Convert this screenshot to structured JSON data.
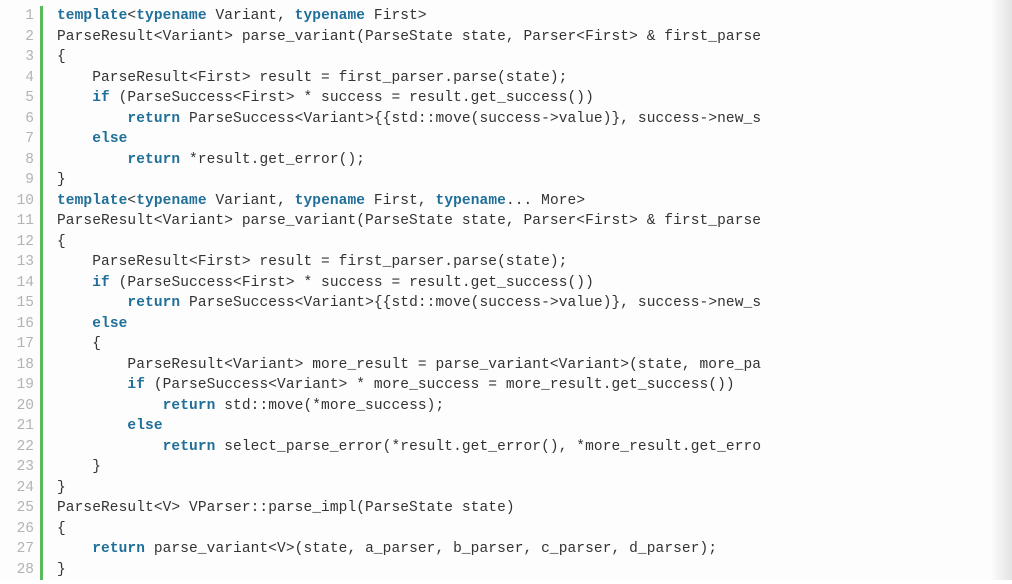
{
  "code": {
    "lines": [
      {
        "n": "1",
        "segs": [
          [
            "kw",
            "template"
          ],
          [
            "t",
            "<"
          ],
          [
            "kw",
            "typename"
          ],
          [
            "t",
            " Variant, "
          ],
          [
            "kw",
            "typename"
          ],
          [
            "t",
            " First>"
          ]
        ]
      },
      {
        "n": "2",
        "segs": [
          [
            "t",
            "ParseResult<Variant> parse_variant(ParseState state, Parser<First> & first_parse"
          ]
        ]
      },
      {
        "n": "3",
        "segs": [
          [
            "t",
            "{"
          ]
        ]
      },
      {
        "n": "4",
        "segs": [
          [
            "t",
            "    ParseResult<First> result = first_parser.parse(state);"
          ]
        ]
      },
      {
        "n": "5",
        "segs": [
          [
            "t",
            "    "
          ],
          [
            "kw",
            "if"
          ],
          [
            "t",
            " (ParseSuccess<First> * success = result.get_success())"
          ]
        ]
      },
      {
        "n": "6",
        "segs": [
          [
            "t",
            "        "
          ],
          [
            "kw",
            "return"
          ],
          [
            "t",
            " ParseSuccess<Variant>{{std::move(success->value)}, success->new_s"
          ]
        ]
      },
      {
        "n": "7",
        "segs": [
          [
            "t",
            "    "
          ],
          [
            "kw",
            "else"
          ]
        ]
      },
      {
        "n": "8",
        "segs": [
          [
            "t",
            "        "
          ],
          [
            "kw",
            "return"
          ],
          [
            "t",
            " *result.get_error();"
          ]
        ]
      },
      {
        "n": "9",
        "segs": [
          [
            "t",
            "}"
          ]
        ]
      },
      {
        "n": "10",
        "segs": [
          [
            "kw",
            "template"
          ],
          [
            "t",
            "<"
          ],
          [
            "kw",
            "typename"
          ],
          [
            "t",
            " Variant, "
          ],
          [
            "kw",
            "typename"
          ],
          [
            "t",
            " First, "
          ],
          [
            "kw",
            "typename"
          ],
          [
            "t",
            "... More>"
          ]
        ]
      },
      {
        "n": "11",
        "segs": [
          [
            "t",
            "ParseResult<Variant> parse_variant(ParseState state, Parser<First> & first_parse"
          ]
        ]
      },
      {
        "n": "12",
        "segs": [
          [
            "t",
            "{"
          ]
        ]
      },
      {
        "n": "13",
        "segs": [
          [
            "t",
            "    ParseResult<First> result = first_parser.parse(state);"
          ]
        ]
      },
      {
        "n": "14",
        "segs": [
          [
            "t",
            "    "
          ],
          [
            "kw",
            "if"
          ],
          [
            "t",
            " (ParseSuccess<First> * success = result.get_success())"
          ]
        ]
      },
      {
        "n": "15",
        "segs": [
          [
            "t",
            "        "
          ],
          [
            "kw",
            "return"
          ],
          [
            "t",
            " ParseSuccess<Variant>{{std::move(success->value)}, success->new_s"
          ]
        ]
      },
      {
        "n": "16",
        "segs": [
          [
            "t",
            "    "
          ],
          [
            "kw",
            "else"
          ]
        ]
      },
      {
        "n": "17",
        "segs": [
          [
            "t",
            "    {"
          ]
        ]
      },
      {
        "n": "18",
        "segs": [
          [
            "t",
            "        ParseResult<Variant> more_result = parse_variant<Variant>(state, more_pa"
          ]
        ]
      },
      {
        "n": "19",
        "segs": [
          [
            "t",
            "        "
          ],
          [
            "kw",
            "if"
          ],
          [
            "t",
            " (ParseSuccess<Variant> * more_success = more_result.get_success())"
          ]
        ]
      },
      {
        "n": "20",
        "segs": [
          [
            "t",
            "            "
          ],
          [
            "kw",
            "return"
          ],
          [
            "t",
            " std::move(*more_success);"
          ]
        ]
      },
      {
        "n": "21",
        "segs": [
          [
            "t",
            "        "
          ],
          [
            "kw",
            "else"
          ]
        ]
      },
      {
        "n": "22",
        "segs": [
          [
            "t",
            "            "
          ],
          [
            "kw",
            "return"
          ],
          [
            "t",
            " select_parse_error(*result.get_error(), *more_result.get_erro"
          ]
        ]
      },
      {
        "n": "23",
        "segs": [
          [
            "t",
            "    }"
          ]
        ]
      },
      {
        "n": "24",
        "segs": [
          [
            "t",
            "}"
          ]
        ]
      },
      {
        "n": "25",
        "segs": [
          [
            "t",
            "ParseResult<V> VParser::parse_impl(ParseState state)"
          ]
        ]
      },
      {
        "n": "26",
        "segs": [
          [
            "t",
            "{"
          ]
        ]
      },
      {
        "n": "27",
        "segs": [
          [
            "t",
            "    "
          ],
          [
            "kw",
            "return"
          ],
          [
            "t",
            " parse_variant<V>(state, a_parser, b_parser, c_parser, d_parser);"
          ]
        ]
      },
      {
        "n": "28",
        "segs": [
          [
            "t",
            "}"
          ]
        ]
      }
    ]
  }
}
